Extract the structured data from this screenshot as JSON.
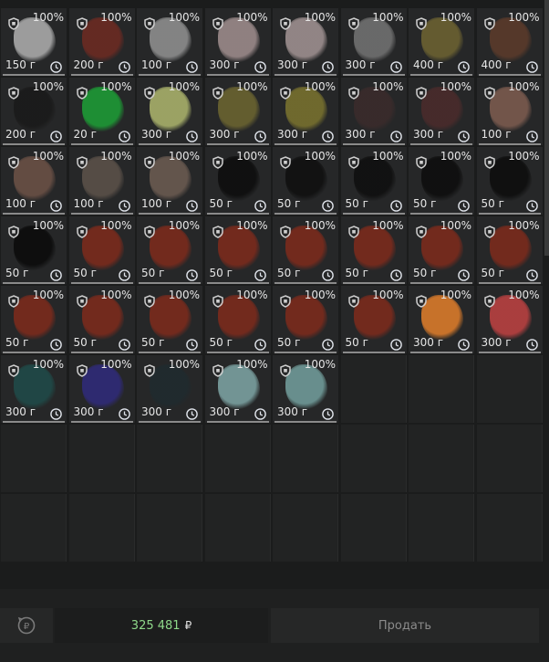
{
  "inventory": {
    "items": [
      {
        "condition": "100%",
        "weight": "150 г",
        "color": "#a9a9a9"
      },
      {
        "condition": "100%",
        "weight": "200 г",
        "color": "#6b2a22"
      },
      {
        "condition": "100%",
        "weight": "100 г",
        "color": "#8d8d8d"
      },
      {
        "condition": "100%",
        "weight": "300 г",
        "color": "#9b8a8a"
      },
      {
        "condition": "100%",
        "weight": "300 г",
        "color": "#9d8f8f"
      },
      {
        "condition": "100%",
        "weight": "300 г",
        "color": "#707070"
      },
      {
        "condition": "100%",
        "weight": "400 г",
        "color": "#6b6131"
      },
      {
        "condition": "100%",
        "weight": "400 г",
        "color": "#5a3a2a"
      },
      {
        "condition": "100%",
        "weight": "200 г",
        "color": "#1a1a1a"
      },
      {
        "condition": "100%",
        "weight": "20 г",
        "color": "#1d9a35"
      },
      {
        "condition": "100%",
        "weight": "300 г",
        "color": "#a8b06a"
      },
      {
        "condition": "100%",
        "weight": "300 г",
        "color": "#6a6330"
      },
      {
        "condition": "100%",
        "weight": "300 г",
        "color": "#77702e"
      },
      {
        "condition": "100%",
        "weight": "300 г",
        "color": "#3a2b2b"
      },
      {
        "condition": "100%",
        "weight": "300 г",
        "color": "#4a2b2b"
      },
      {
        "condition": "100%",
        "weight": "100 г",
        "color": "#7a5a4e"
      },
      {
        "condition": "100%",
        "weight": "100 г",
        "color": "#6a5045"
      },
      {
        "condition": "100%",
        "weight": "100 г",
        "color": "#5a5048"
      },
      {
        "condition": "100%",
        "weight": "100 г",
        "color": "#6a5a50"
      },
      {
        "condition": "100%",
        "weight": "50 г",
        "color": "#0e0e0e"
      },
      {
        "condition": "100%",
        "weight": "50 г",
        "color": "#101010"
      },
      {
        "condition": "100%",
        "weight": "50 г",
        "color": "#0f0f0f"
      },
      {
        "condition": "100%",
        "weight": "50 г",
        "color": "#0e0e0e"
      },
      {
        "condition": "100%",
        "weight": "50 г",
        "color": "#0d0d0d"
      },
      {
        "condition": "100%",
        "weight": "50 г",
        "color": "#0b0b0b"
      },
      {
        "condition": "100%",
        "weight": "50 г",
        "color": "#7a2a1c"
      },
      {
        "condition": "100%",
        "weight": "50 г",
        "color": "#7a2a1c"
      },
      {
        "condition": "100%",
        "weight": "50 г",
        "color": "#7a2a1c"
      },
      {
        "condition": "100%",
        "weight": "50 г",
        "color": "#7a2a1c"
      },
      {
        "condition": "100%",
        "weight": "50 г",
        "color": "#7a2a1c"
      },
      {
        "condition": "100%",
        "weight": "50 г",
        "color": "#7a2a1c"
      },
      {
        "condition": "100%",
        "weight": "50 г",
        "color": "#7a2a1c"
      },
      {
        "condition": "100%",
        "weight": "50 г",
        "color": "#7a2a1c"
      },
      {
        "condition": "100%",
        "weight": "50 г",
        "color": "#7a2a1c"
      },
      {
        "condition": "100%",
        "weight": "50 г",
        "color": "#7a2a1c"
      },
      {
        "condition": "100%",
        "weight": "50 г",
        "color": "#7a2a1c"
      },
      {
        "condition": "100%",
        "weight": "50 г",
        "color": "#7a2a1c"
      },
      {
        "condition": "100%",
        "weight": "50 г",
        "color": "#7a2a1c"
      },
      {
        "condition": "100%",
        "weight": "300 г",
        "color": "#d97a2a"
      },
      {
        "condition": "100%",
        "weight": "300 г",
        "color": "#b84040"
      },
      {
        "condition": "100%",
        "weight": "300 г",
        "color": "#1f4a48"
      },
      {
        "condition": "100%",
        "weight": "300 г",
        "color": "#2f2a78"
      },
      {
        "condition": "100%",
        "weight": "300 г",
        "color": "#1f2a2e"
      },
      {
        "condition": "100%",
        "weight": "300 г",
        "color": "#7aa0a0"
      },
      {
        "condition": "100%",
        "weight": "300 г",
        "color": "#6f9a98"
      }
    ]
  },
  "footer": {
    "balance_value": "325 481",
    "currency_symbol": "₽",
    "sell_label": "Продать"
  }
}
